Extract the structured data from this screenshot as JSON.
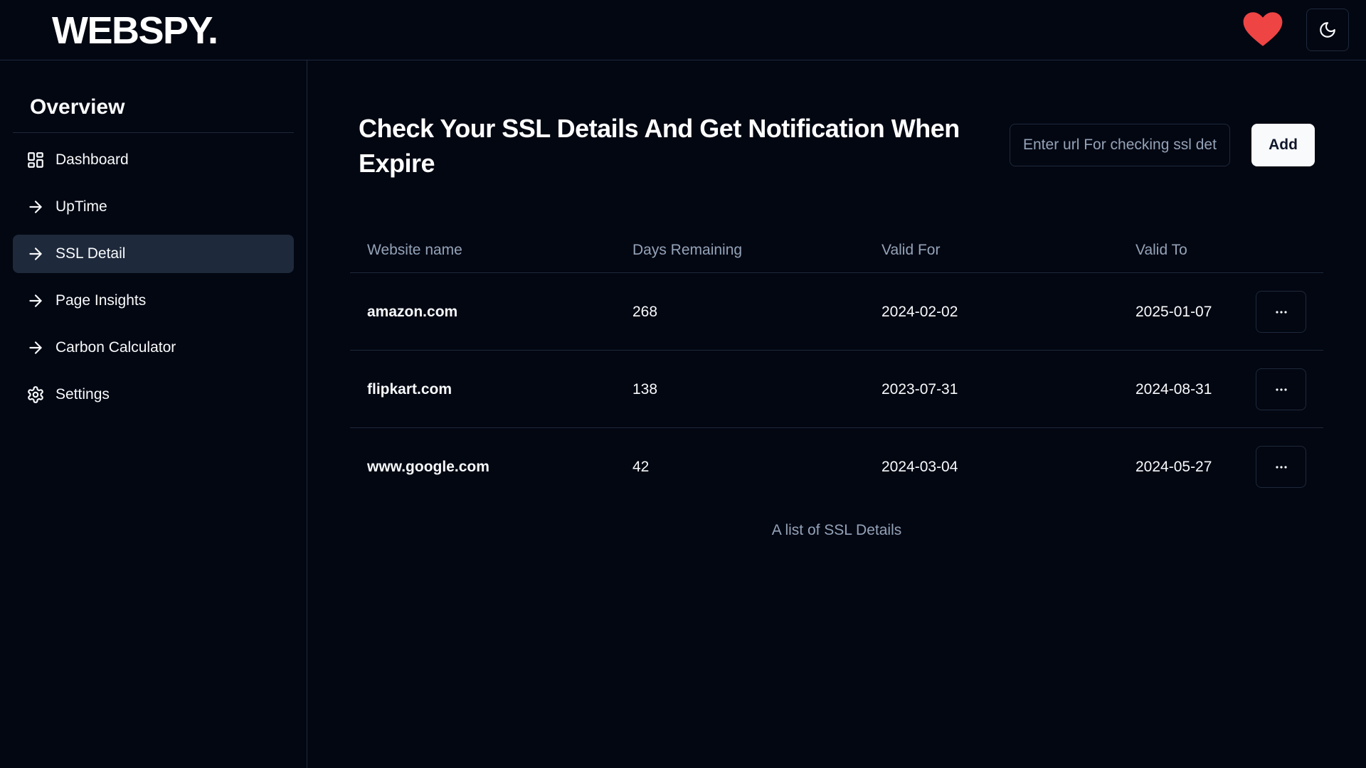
{
  "header": {
    "logo": "WEBSPY.",
    "heart_icon": "heart-icon",
    "theme_icon": "moon-icon"
  },
  "sidebar": {
    "title": "Overview",
    "items": [
      {
        "label": "Dashboard",
        "icon": "dashboard-grid-icon",
        "active": false
      },
      {
        "label": "UpTime",
        "icon": "arrow-right-icon",
        "active": false
      },
      {
        "label": "SSL Detail",
        "icon": "arrow-right-icon",
        "active": true
      },
      {
        "label": "Page Insights",
        "icon": "arrow-right-icon",
        "active": false
      },
      {
        "label": "Carbon Calculator",
        "icon": "arrow-right-icon",
        "active": false
      },
      {
        "label": "Settings",
        "icon": "gear-icon",
        "active": false
      }
    ]
  },
  "main": {
    "title": "Check Your SSL Details And Get Notification When Expire",
    "url_input": {
      "placeholder": "Enter url For checking ssl details",
      "value": ""
    },
    "add_label": "Add",
    "table": {
      "headers": [
        "Website name",
        "Days Remaining",
        "Valid For",
        "Valid To"
      ],
      "rows": [
        {
          "site": "amazon.com",
          "days": "268",
          "valid_for": "2024-02-02",
          "valid_to": "2025-01-07"
        },
        {
          "site": "flipkart.com",
          "days": "138",
          "valid_for": "2023-07-31",
          "valid_to": "2024-08-31"
        },
        {
          "site": "www.google.com",
          "days": "42",
          "valid_for": "2024-03-04",
          "valid_to": "2024-05-27"
        }
      ],
      "caption": "A list of SSL Details"
    }
  },
  "colors": {
    "background": "#030712",
    "border": "#1e293b",
    "heart": "#ef4444",
    "muted_text": "#94a3b8"
  }
}
